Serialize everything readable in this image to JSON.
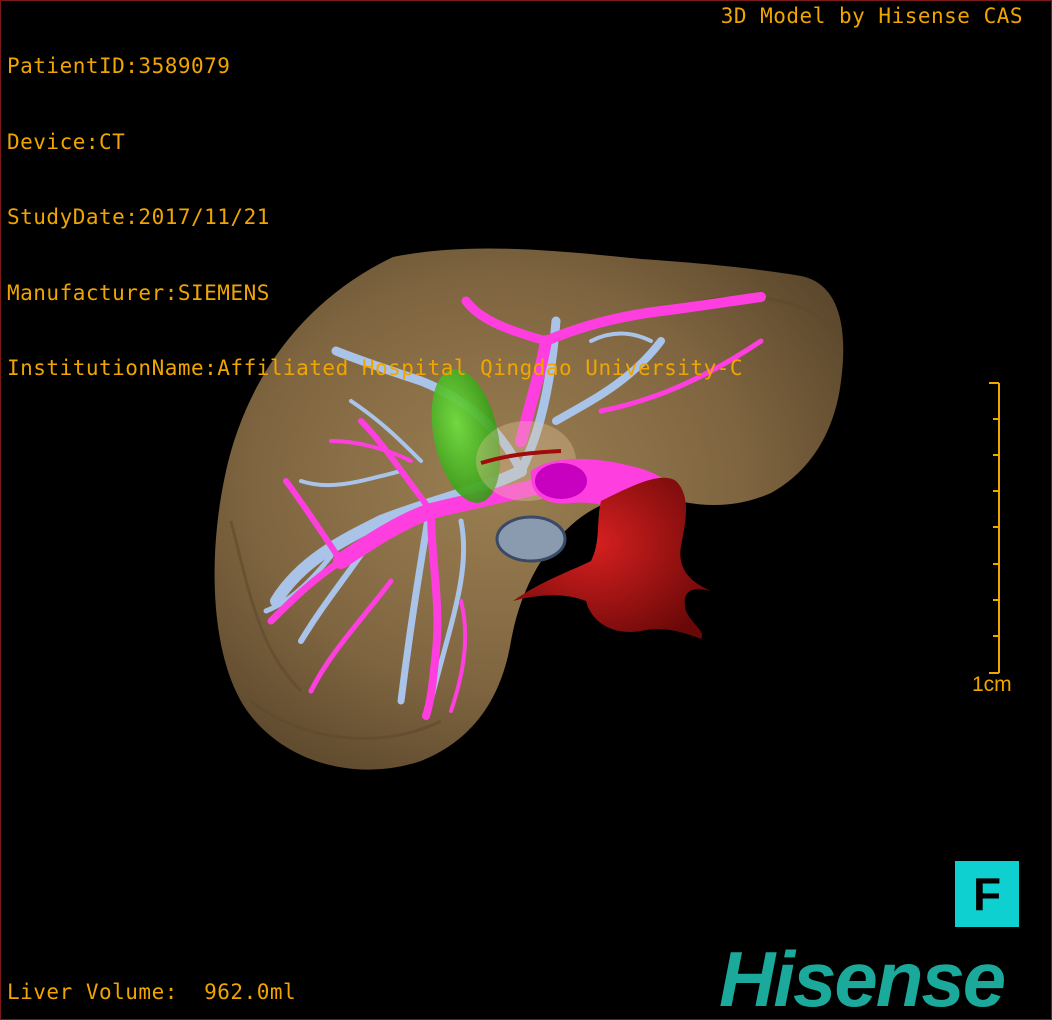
{
  "header": {
    "patient_id": "PatientID:3589079",
    "device": "Device:CT",
    "study_date": "StudyDate:2017/11/21",
    "manufacturer": "Manufacturer:SIEMENS",
    "institution": "InstitutionName:Affiliated Hospital Qingdao University-C"
  },
  "credit": "3D Model by Hisense CAS",
  "footer": {
    "liver_volume": "Liver Volume:  962.0ml"
  },
  "scale": {
    "label": "1cm"
  },
  "orientation": {
    "label": "F"
  },
  "brand": {
    "logo_text": "Hisense"
  },
  "colors": {
    "overlay_text": "#f0a500",
    "liver": "#8a6f45",
    "portal_vein": "#ff3ee0",
    "hepatic_vein": "#a9c4e8",
    "gallbladder": "#3fbf1f",
    "artery": "#b50f0f",
    "orientation_cube": "#0fd0d0",
    "brand": "#1aa99a"
  }
}
